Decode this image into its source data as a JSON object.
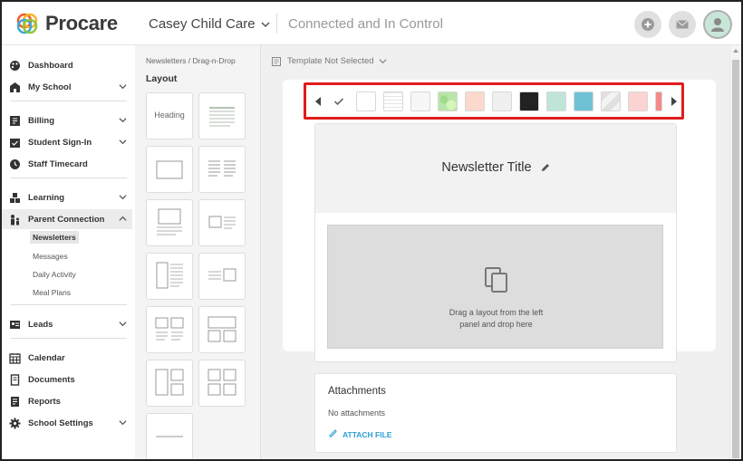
{
  "app": {
    "brand": "Procare",
    "center_name": "Casey Child Care",
    "tagline": "Connected and In Control",
    "header_icons": [
      "plus-icon",
      "mail-icon",
      "avatar"
    ]
  },
  "sidebar": {
    "items": [
      {
        "label": "Dashboard",
        "icon": "palette-icon"
      },
      {
        "label": "My School",
        "icon": "school-icon",
        "expandable": true
      },
      {
        "label": "Billing",
        "icon": "billing-icon",
        "expandable": true
      },
      {
        "label": "Student Sign-In",
        "icon": "sign-in-icon",
        "expandable": true
      },
      {
        "label": "Staff Timecard",
        "icon": "timecard-icon"
      },
      {
        "label": "Learning",
        "icon": "learning-icon",
        "expandable": true
      },
      {
        "label": "Parent Connection",
        "icon": "family-icon",
        "expandable": true,
        "expanded": true
      },
      {
        "label": "Leads",
        "icon": "leads-icon",
        "expandable": true
      },
      {
        "label": "Calendar",
        "icon": "calendar-icon"
      },
      {
        "label": "Documents",
        "icon": "documents-icon"
      },
      {
        "label": "Reports",
        "icon": "reports-icon"
      },
      {
        "label": "School Settings",
        "icon": "settings-icon",
        "expandable": true
      }
    ],
    "subitems": [
      "Newsletters",
      "Messages",
      "Daily Activity",
      "Meal Plans"
    ],
    "active_subitem": "Newsletters"
  },
  "layout_panel": {
    "breadcrumb_parent": "Newsletters",
    "breadcrumb_sep": "/",
    "breadcrumb_current": "Drag-n-Drop",
    "title": "Layout",
    "heading_tile_label": "Heading"
  },
  "main": {
    "template_label": "Template Not Selected",
    "swatches": [
      "#ffffff",
      "#ffffff",
      "#eaeaea",
      "#f7f7f7",
      "#b8e6a8",
      "#fbd9cc",
      "#f0f0f0",
      "#222222",
      "#bfe5d8",
      "#6fc2d4",
      "#e6e6e6",
      "#fbd3d3",
      "#f48a8a"
    ],
    "newsletter_title": "Newsletter Title",
    "drop_text_line1": "Drag a layout from the left",
    "drop_text_line2": "panel and drop here",
    "attachments_title": "Attachments",
    "attachments_empty": "No attachments",
    "attach_button": "ATTACH FILE"
  },
  "colors": {
    "accent": "#2b9fd4",
    "highlight_border": "#e01c1c"
  }
}
